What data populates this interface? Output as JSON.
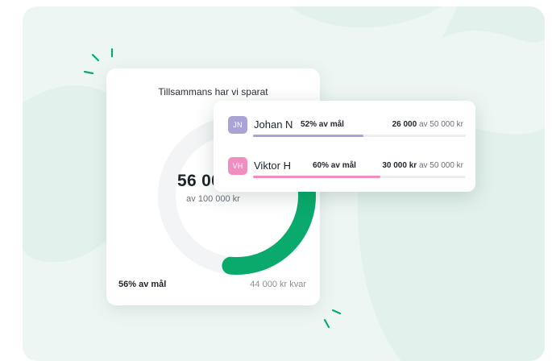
{
  "main_card": {
    "title": "Tillsammans har vi sparat",
    "amount_visible": "56 00",
    "of_total": "av 100 000 kr",
    "progress_label": "56% av mål",
    "remaining": "44 000 kr kvar",
    "progress_fraction": 0.56
  },
  "people": [
    {
      "initials": "JN",
      "name": "Johan N",
      "percent": "52% av mål",
      "amount": "26 000",
      "of": "av 50 000 kr",
      "fraction": 0.52,
      "color": "#a9a3d6"
    },
    {
      "initials": "VH",
      "name": "Viktor H",
      "percent": "60% av mål",
      "amount": "30 000 kr",
      "of": "av 50 000 kr",
      "fraction": 0.6,
      "color": "#f08fbf"
    }
  ],
  "colors": {
    "accent_green": "#0aaa6c",
    "track_gray": "#f2f4f5",
    "background_mint": "#eef6f3"
  }
}
